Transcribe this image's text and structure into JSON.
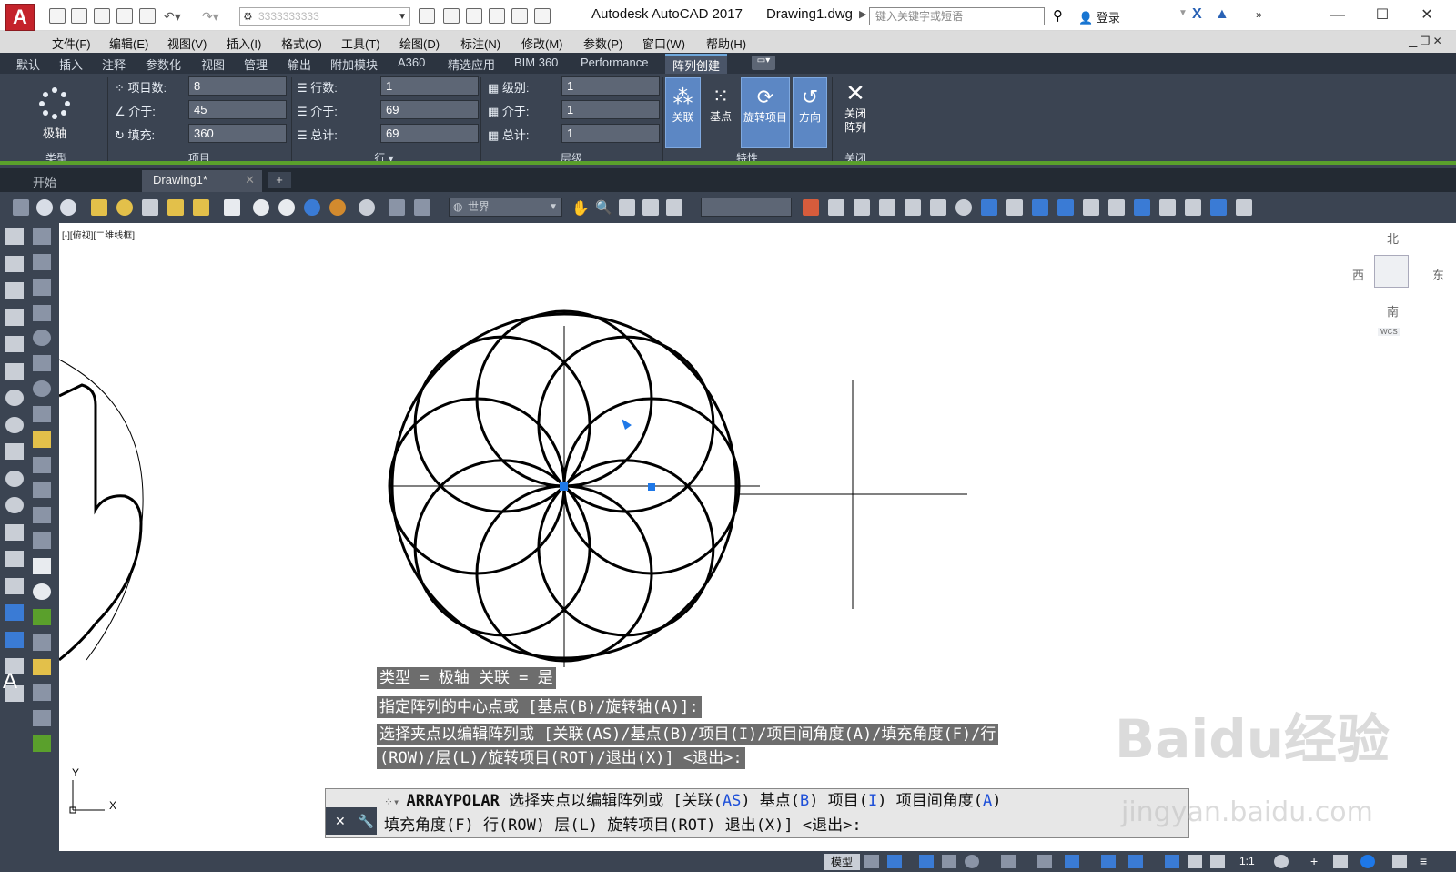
{
  "app": {
    "logo": "A",
    "product": "Autodesk AutoCAD 2017",
    "document": "Drawing1.dwg",
    "workspace": "3333333333",
    "search_placeholder": "键入关键字或短语",
    "signin": "登录"
  },
  "menu": [
    "文件(F)",
    "编辑(E)",
    "视图(V)",
    "插入(I)",
    "格式(O)",
    "工具(T)",
    "绘图(D)",
    "标注(N)",
    "修改(M)",
    "参数(P)",
    "窗口(W)",
    "帮助(H)"
  ],
  "ribbon_tabs": [
    "默认",
    "插入",
    "注释",
    "参数化",
    "视图",
    "管理",
    "输出",
    "附加模块",
    "A360",
    "精选应用",
    "BIM 360",
    "Performance",
    "阵列创建"
  ],
  "ribbon": {
    "type_panel": {
      "button": "极轴",
      "title": "类型"
    },
    "items_panel": {
      "title": "项目",
      "fields": [
        {
          "label": "项目数:",
          "value": "8"
        },
        {
          "label": "介于:",
          "value": "45"
        },
        {
          "label": "填充:",
          "value": "360"
        }
      ]
    },
    "rows_panel": {
      "title": "行 ▾",
      "fields": [
        {
          "label": "行数:",
          "value": "1"
        },
        {
          "label": "介于:",
          "value": "69"
        },
        {
          "label": "总计:",
          "value": "69"
        }
      ]
    },
    "levels_panel": {
      "title": "层级",
      "fields": [
        {
          "label": "级别:",
          "value": "1"
        },
        {
          "label": "介于:",
          "value": "1"
        },
        {
          "label": "总计:",
          "value": "1"
        }
      ]
    },
    "props_panel": {
      "title": "特性",
      "buttons": [
        "关联",
        "基点",
        "旋转项目",
        "方向"
      ]
    },
    "close_panel": {
      "title": "关闭",
      "button_line1": "关闭",
      "button_line2": "阵列"
    }
  },
  "doc_tabs": [
    "开始",
    "Drawing1*"
  ],
  "view_combo": "世界",
  "viewport_label": "[-][俯视][二维线框]",
  "viewcube": {
    "n": "北",
    "s": "南",
    "e": "东",
    "w": "西",
    "wcs": "WCS"
  },
  "ucs": {
    "y": "Y",
    "x": "X"
  },
  "prompts": [
    "类型 = 极轴  关联 = 是",
    "指定阵列的中心点或 [基点(B)/旋转轴(A)]:",
    "选择夹点以编辑阵列或 [关联(AS)/基点(B)/项目(I)/项目间角度(A)/填充角度(F)/行",
    "(ROW)/层(L)/旋转项目(ROT)/退出(X)] <退出>:"
  ],
  "cmdline": {
    "command": "ARRAYPOLAR",
    "line1_rest": " 选择夹点以编辑阵列或 [关联(",
    "line2": "填充角度(F) 行(ROW) 层(L) 旋转项目(ROT) 退出(X)] <退出>:"
  },
  "status": {
    "model": "模型",
    "scale": "1:1"
  },
  "watermark": {
    "line1": "Baidu经验",
    "line2": "jingyan.baidu.com"
  }
}
